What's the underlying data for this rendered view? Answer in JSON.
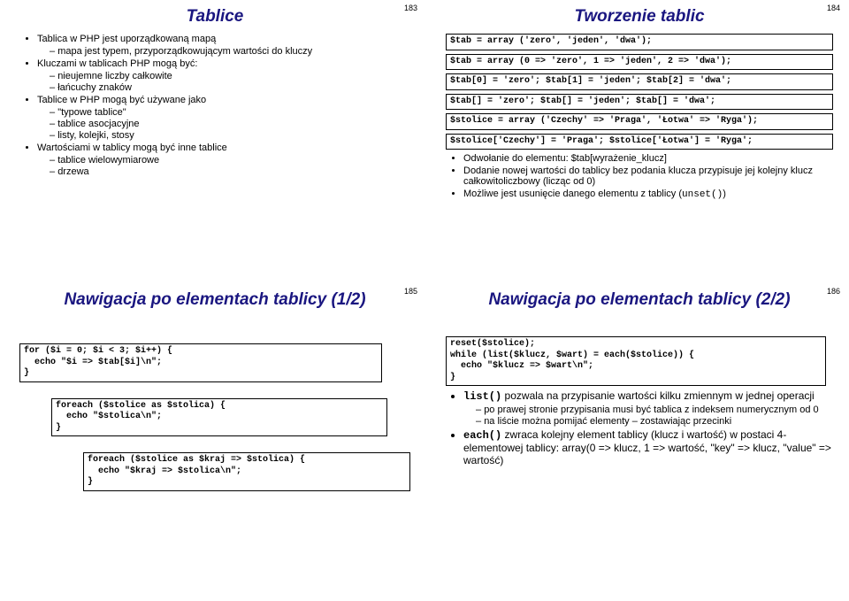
{
  "slide1": {
    "num": "183",
    "title": "Tablice",
    "b1a": "Tablica w PHP jest uporządkowaną mapą",
    "b1a_s1": "mapa jest typem, przyporządkowującym wartości do kluczy",
    "b1b": "Kluczami w tablicach PHP mogą być:",
    "b1b_s1": "nieujemne liczby całkowite",
    "b1b_s2": "łańcuchy znaków",
    "b1c": "Tablice w PHP mogą być używane jako",
    "b1c_s1": "\"typowe tablice\"",
    "b1c_s2": "tablice asocjacyjne",
    "b1c_s3": "listy, kolejki, stosy",
    "b1d": "Wartościami w tablicy mogą być inne tablice",
    "b1d_s1": "tablice wielowymiarowe",
    "b1d_s2": "drzewa"
  },
  "slide2": {
    "num": "184",
    "title": "Tworzenie tablic",
    "code1": "$tab = array ('zero', 'jeden', 'dwa');",
    "code2": "$tab = array (0 => 'zero', 1 => 'jeden', 2 => 'dwa');",
    "code3": "$tab[0] = 'zero'; $tab[1] = 'jeden'; $tab[2] = 'dwa';",
    "code4": "$tab[] = 'zero'; $tab[] = 'jeden'; $tab[] = 'dwa';",
    "code5": "$stolice = array ('Czechy' => 'Praga', 'Łotwa' => 'Ryga');",
    "code6": "$stolice['Czechy'] = 'Praga'; $stolice['Łotwa'] = 'Ryga';",
    "b1a": "Odwołanie do elementu: $tab[wyrażenie_klucz]",
    "b1b": "Dodanie nowej wartości do tablicy bez podania klucza przypisuje jej kolejny klucz całkowitoliczbowy (licząc od 0)",
    "b1c_pre": "Możliwe jest usunięcie danego elementu z tablicy (",
    "b1c_code": "unset()",
    "b1c_post": ")"
  },
  "slide3": {
    "num": "185",
    "title": "Nawigacja po elementach tablicy (1/2)",
    "code1": "for ($i = 0; $i < 3; $i++) {\n  echo \"$i => $tab[$i]\\n\";\n}",
    "code2": "foreach ($stolice as $stolica) {\n  echo \"$stolica\\n\";\n}",
    "code3": "foreach ($stolice as $kraj => $stolica) {\n  echo \"$kraj => $stolica\\n\";\n}"
  },
  "slide4": {
    "num": "186",
    "title": "Nawigacja po elementach tablicy (2/2)",
    "code1": "reset($stolice);\nwhile (list($klucz, $wart) = each($stolice)) {\n  echo \"$klucz => $wart\\n\";\n}",
    "b1a_code": "list()",
    "b1a_txt": " pozwala na przypisanie wartości kilku zmiennym w jednej operacji",
    "b1a_s1": "po prawej stronie przypisania musi być tablica z indeksem numerycznym od 0",
    "b1a_s2": "na liście można pomijać elementy – zostawiając przecinki",
    "b1b_code": "each()",
    "b1b_txt": " zwraca kolejny element tablicy (klucz i wartość) w postaci 4-elementowej tablicy: array(0 => klucz, 1 => wartość, \"key\" => klucz, \"value\" => wartość)"
  }
}
